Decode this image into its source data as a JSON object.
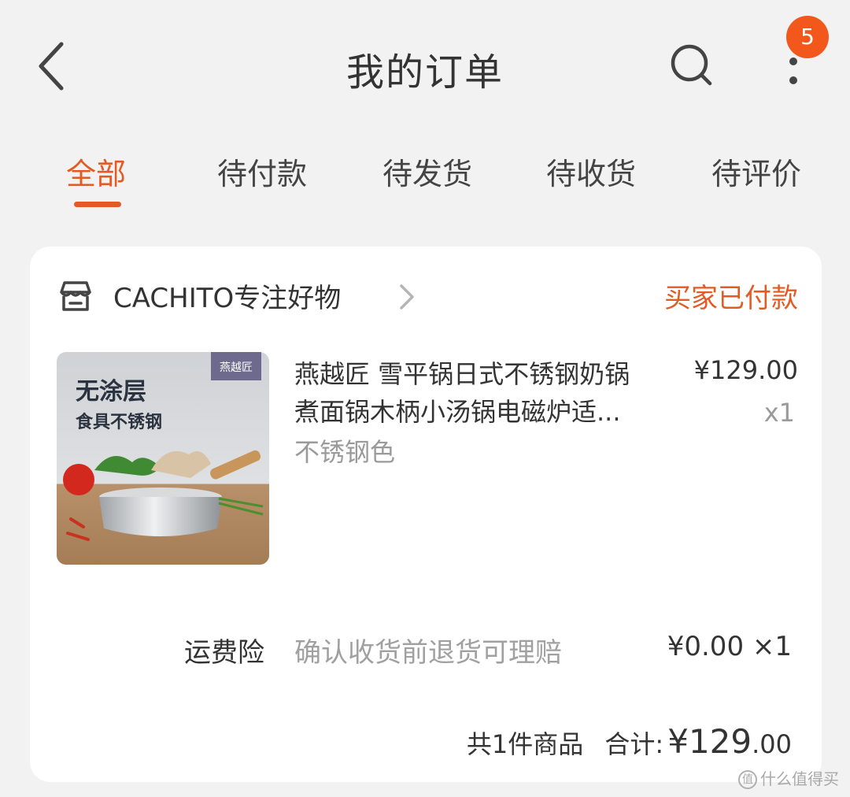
{
  "header": {
    "title": "我的订单",
    "badge_count": "5"
  },
  "tabs": [
    {
      "label": "全部",
      "active": true
    },
    {
      "label": "待付款",
      "active": false
    },
    {
      "label": "待发货",
      "active": false
    },
    {
      "label": "待收货",
      "active": false
    },
    {
      "label": "待评价",
      "active": false
    }
  ],
  "order": {
    "shop_name": "CACHITO专注好物",
    "status": "买家已付款",
    "product": {
      "image_brand": "燕越匠",
      "image_line1": "无涂层",
      "image_line2": "食具不锈钢",
      "title_line1": "燕越匠 雪平锅日式不锈钢奶锅",
      "title_line2": "煮面锅木柄小汤锅电磁炉适...",
      "variant": "不锈钢色",
      "price": "¥129.00",
      "qty": "x1"
    },
    "insurance": {
      "label": "运费险",
      "desc": "确认收货前退货可理赔",
      "price": "¥0.00 ×1"
    },
    "summary": {
      "count_text": "共1件商品",
      "total_label": "合计:",
      "total_main": "¥129",
      "total_cents": ".00"
    }
  },
  "watermark": {
    "icon_char": "值",
    "text": "什么值得买"
  },
  "colors": {
    "accent": "#e35b22",
    "badge": "#f2571c",
    "background": "#f2f2f2"
  }
}
